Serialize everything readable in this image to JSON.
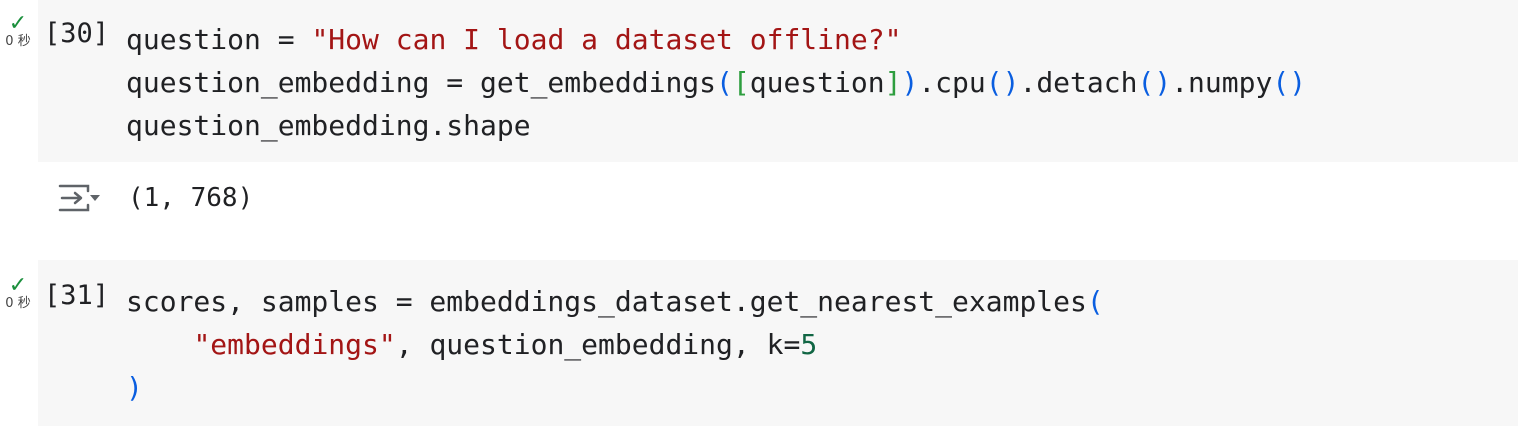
{
  "cells": [
    {
      "status": {
        "check": "✓",
        "time": "0 秒"
      },
      "exec_count": "[30]",
      "code": {
        "l1_var": "question",
        "l1_eq": " = ",
        "l1_str": "\"How can I load a dataset offline?\"",
        "l2_var": "question_embedding = get_embeddings",
        "l2_p1o": "(",
        "l2_b1o": "[",
        "l2_arg": "question",
        "l2_b1c": "]",
        "l2_p1c": ")",
        "l2_cpu": ".cpu",
        "l2_cpu_o": "(",
        "l2_cpu_c": ")",
        "l2_detach": ".detach",
        "l2_det_o": "(",
        "l2_det_c": ")",
        "l2_numpy": ".numpy",
        "l2_np_o": "(",
        "l2_np_c": ")",
        "l3": "question_embedding.shape"
      },
      "output": {
        "text": "(1, 768)",
        "icon": "output-toggle-icon"
      }
    },
    {
      "status": {
        "check": "✓",
        "time": "0 秒"
      },
      "exec_count": "[31]",
      "code": {
        "l1_text": "scores, samples = embeddings_dataset.get_nearest_examples",
        "l1_open": "(",
        "l2_indent": "    ",
        "l2_str": "\"embeddings\"",
        "l2_mid": ", question_embedding, k=",
        "l2_num": "5",
        "l3_close": ")"
      }
    }
  ],
  "colors": {
    "string": "#a31515",
    "number": "#116644",
    "bracket_level1": "#0a5ee0",
    "bracket_level2": "#2e9e3f",
    "status_check": "#1a8f3c",
    "cell_background": "#f7f7f7"
  }
}
